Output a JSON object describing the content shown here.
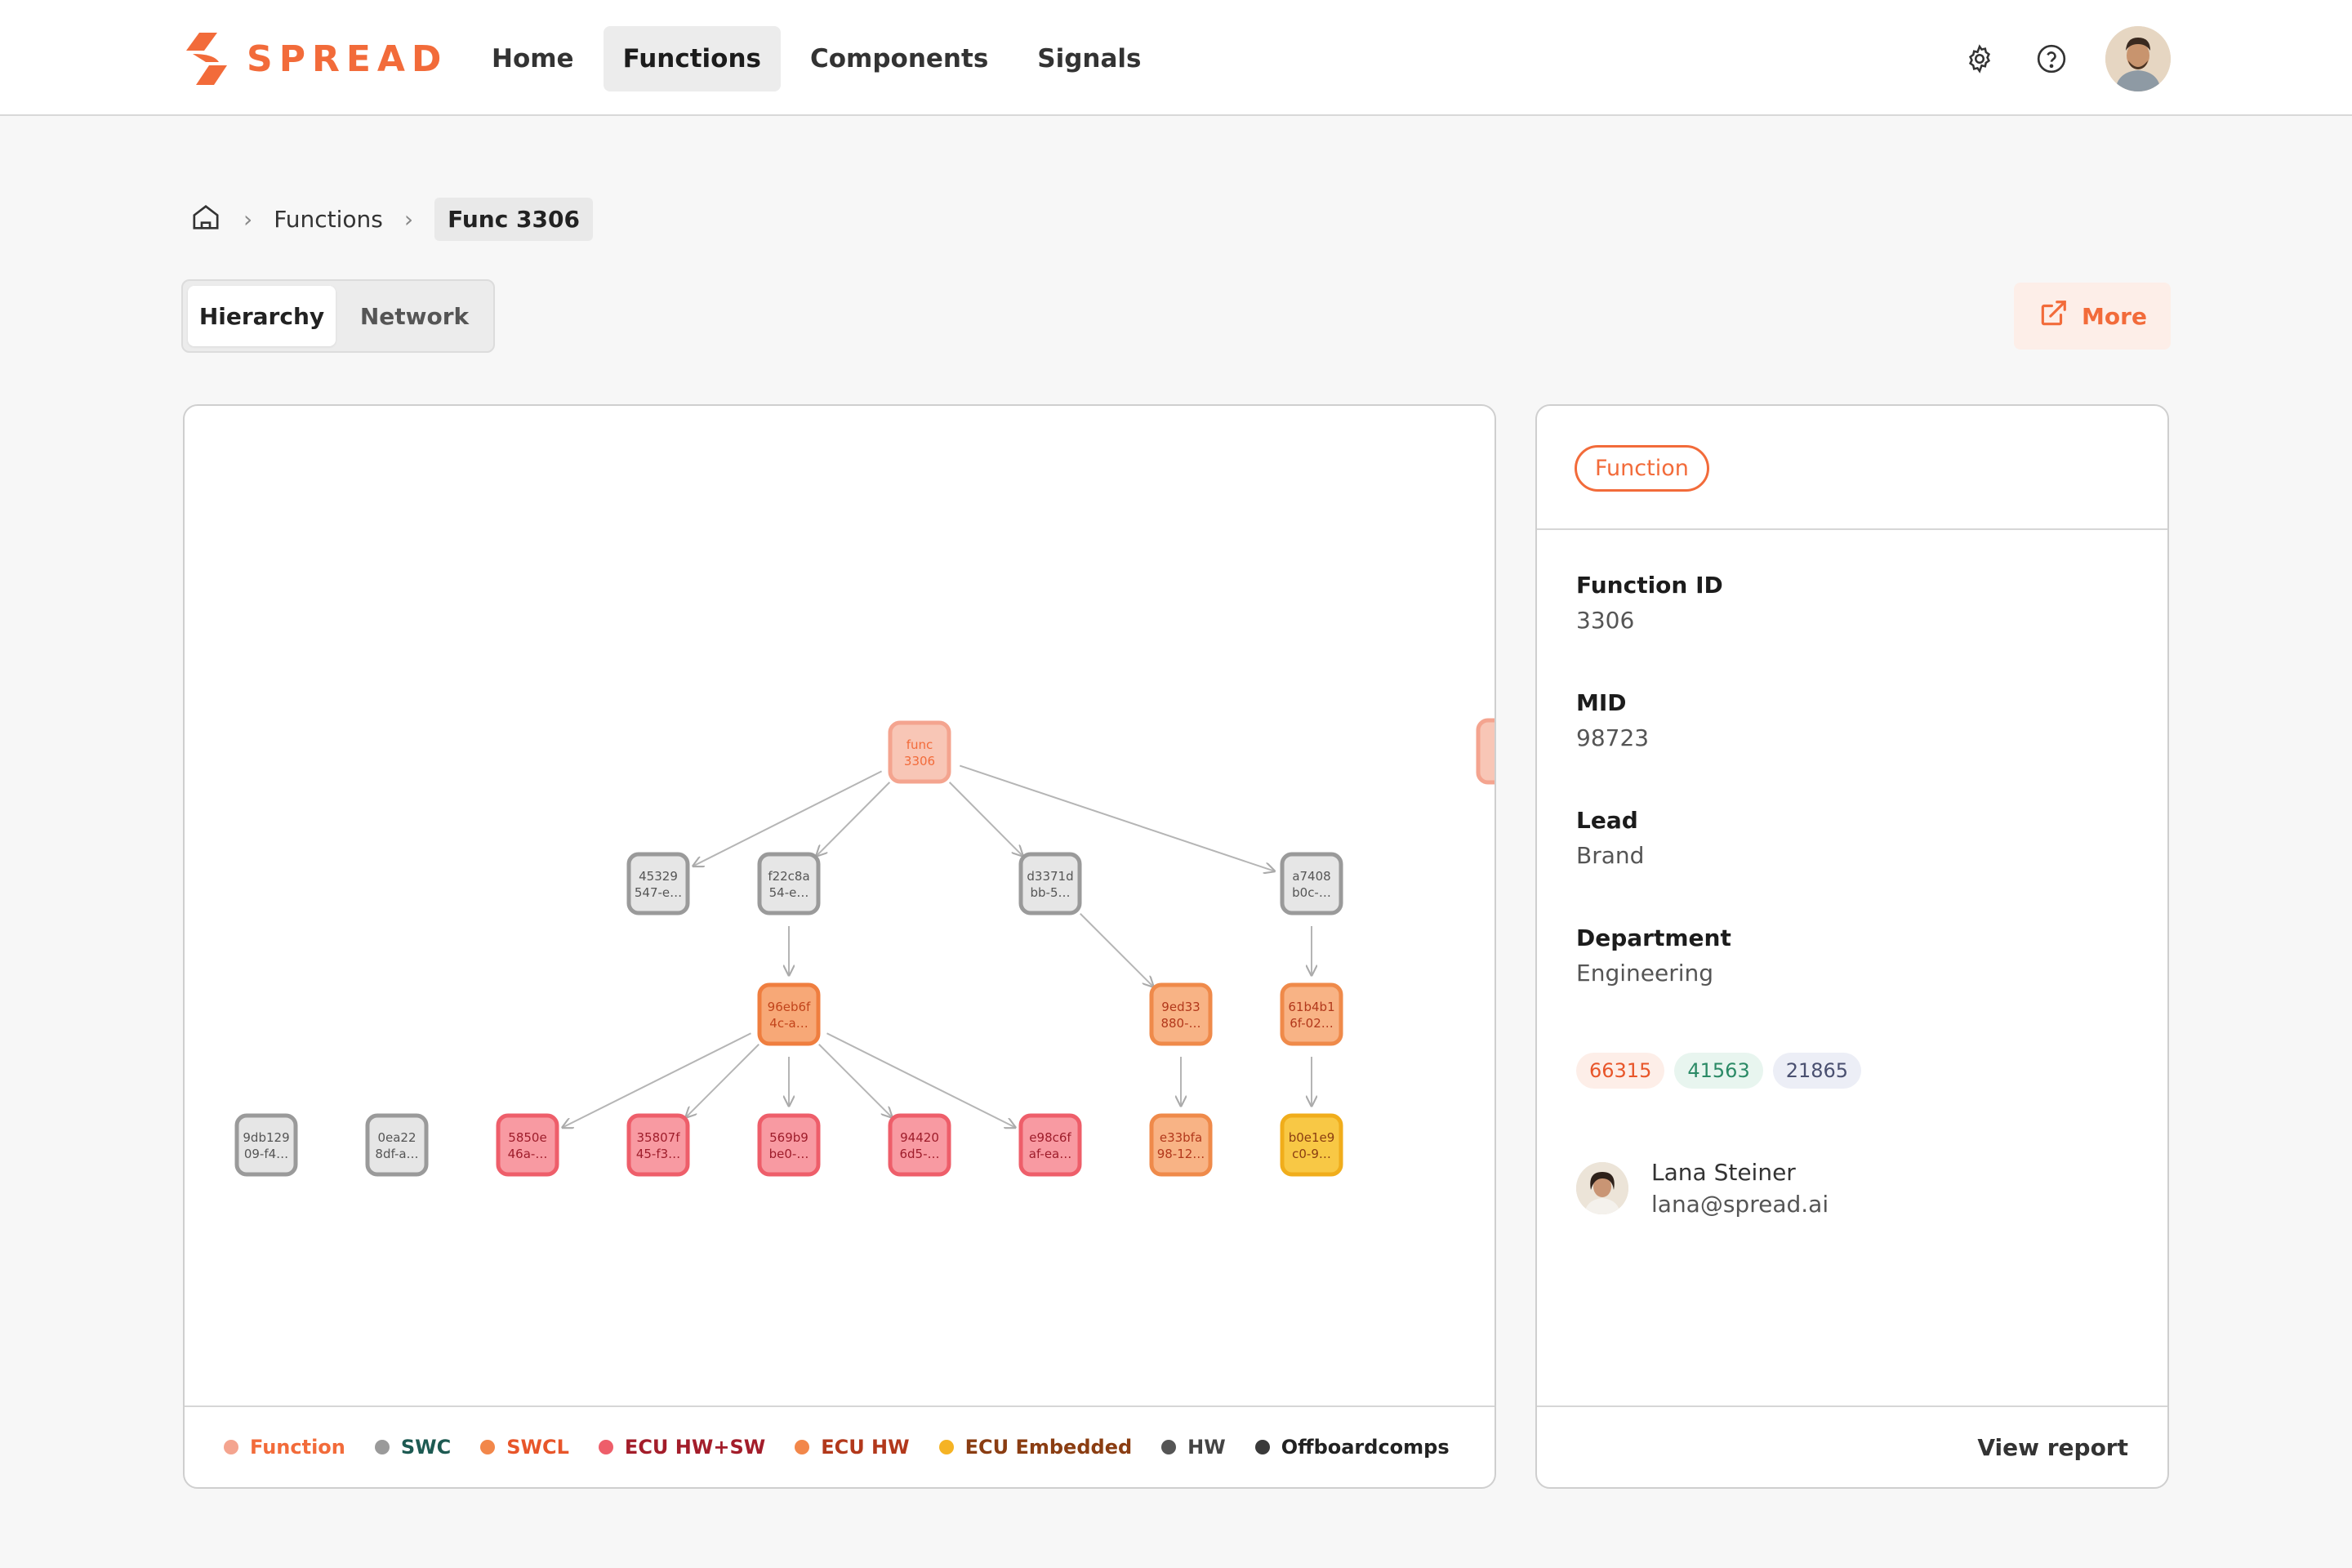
{
  "brand": {
    "name": "SPREAD",
    "accent": "#f26b3a"
  },
  "nav": {
    "items": [
      {
        "label": "Home",
        "active": false
      },
      {
        "label": "Functions",
        "active": true
      },
      {
        "label": "Components",
        "active": false
      },
      {
        "label": "Signals",
        "active": false
      }
    ],
    "icons": [
      "gear-icon",
      "help-icon"
    ]
  },
  "breadcrumb": {
    "home_icon": "home-icon",
    "section": "Functions",
    "current": "Func 3306"
  },
  "view_tabs": {
    "hierarchy": "Hierarchy",
    "network": "Network",
    "active": "Hierarchy"
  },
  "more_button": {
    "label": "More",
    "icon": "external-link-icon"
  },
  "graph": {
    "nodes": [
      {
        "id": "n0",
        "line1": "func",
        "line2": "3306",
        "type": "Function"
      },
      {
        "id": "n1",
        "line1": "45329",
        "line2": "547-e…",
        "type": "SWC"
      },
      {
        "id": "n2",
        "line1": "f22c8a",
        "line2": "54-e…",
        "type": "SWC"
      },
      {
        "id": "n3",
        "line1": "d3371d",
        "line2": "bb-5…",
        "type": "SWC"
      },
      {
        "id": "n4",
        "line1": "a7408",
        "line2": "b0c-…",
        "type": "SWC"
      },
      {
        "id": "n5",
        "line1": "96eb6f",
        "line2": "4c-a…",
        "type": "SWCL"
      },
      {
        "id": "n6",
        "line1": "9ed33",
        "line2": "880-…",
        "type": "ECU HW"
      },
      {
        "id": "n7",
        "line1": "61b4b1",
        "line2": "6f-02…",
        "type": "ECU HW"
      },
      {
        "id": "n8",
        "line1": "9db129",
        "line2": "09-f4…",
        "type": "SWC"
      },
      {
        "id": "n9",
        "line1": "0ea22",
        "line2": "8df-a…",
        "type": "SWC"
      },
      {
        "id": "n10",
        "line1": "5850e",
        "line2": "46a-…",
        "type": "ECU HW+SW"
      },
      {
        "id": "n11",
        "line1": "35807f",
        "line2": "45-f3…",
        "type": "ECU HW+SW"
      },
      {
        "id": "n12",
        "line1": "569b9",
        "line2": "be0-…",
        "type": "ECU HW+SW"
      },
      {
        "id": "n13",
        "line1": "94420",
        "line2": "6d5-…",
        "type": "ECU HW+SW"
      },
      {
        "id": "n14",
        "line1": "e98c6f",
        "line2": "af-ea…",
        "type": "ECU HW+SW"
      },
      {
        "id": "n15",
        "line1": "e33bfa",
        "line2": "98-12…",
        "type": "ECU HW"
      },
      {
        "id": "n16",
        "line1": "b0e1e9",
        "line2": "c0-9…",
        "type": "ECU Embedded"
      }
    ],
    "edges": [
      [
        "n0",
        "n1"
      ],
      [
        "n0",
        "n2"
      ],
      [
        "n0",
        "n3"
      ],
      [
        "n0",
        "n4"
      ],
      [
        "n2",
        "n5"
      ],
      [
        "n3",
        "n6"
      ],
      [
        "n4",
        "n7"
      ],
      [
        "n5",
        "n10"
      ],
      [
        "n5",
        "n11"
      ],
      [
        "n5",
        "n12"
      ],
      [
        "n5",
        "n13"
      ],
      [
        "n5",
        "n14"
      ],
      [
        "n6",
        "n15"
      ],
      [
        "n7",
        "n16"
      ]
    ]
  },
  "legend": [
    {
      "label": "Function",
      "dot": "#f4a48f",
      "text": "#f26b3a"
    },
    {
      "label": "SWC",
      "dot": "#9a9a9a",
      "text": "#1d5a52"
    },
    {
      "label": "SWCL",
      "dot": "#f2874a",
      "text": "#e8562a"
    },
    {
      "label": "ECU HW+SW",
      "dot": "#ee5e6a",
      "text": "#a31d2a"
    },
    {
      "label": "ECU HW",
      "dot": "#f2874a",
      "text": "#b2381b"
    },
    {
      "label": "ECU Embedded",
      "dot": "#f5b324",
      "text": "#8a3d12"
    },
    {
      "label": "HW",
      "dot": "#555555",
      "text": "#444444"
    },
    {
      "label": "Offboardcomps",
      "dot": "#3a3a3a",
      "text": "#222222"
    }
  ],
  "details": {
    "type_pill": "Function",
    "fields": [
      {
        "label": "Function ID",
        "value": "3306"
      },
      {
        "label": "MID",
        "value": "98723"
      },
      {
        "label": "Lead",
        "value": "Brand"
      },
      {
        "label": "Department",
        "value": "Engineering"
      }
    ],
    "tags": [
      {
        "label": "66315",
        "bg": "#fdeee8",
        "fg": "#e8562a"
      },
      {
        "label": "41563",
        "bg": "#e8f5ef",
        "fg": "#2b8a66"
      },
      {
        "label": "21865",
        "bg": "#eceef6",
        "fg": "#4a5070"
      }
    ],
    "person": {
      "name": "Lana Steiner",
      "email": "lana@spread.ai"
    },
    "footer_link": "View report"
  }
}
